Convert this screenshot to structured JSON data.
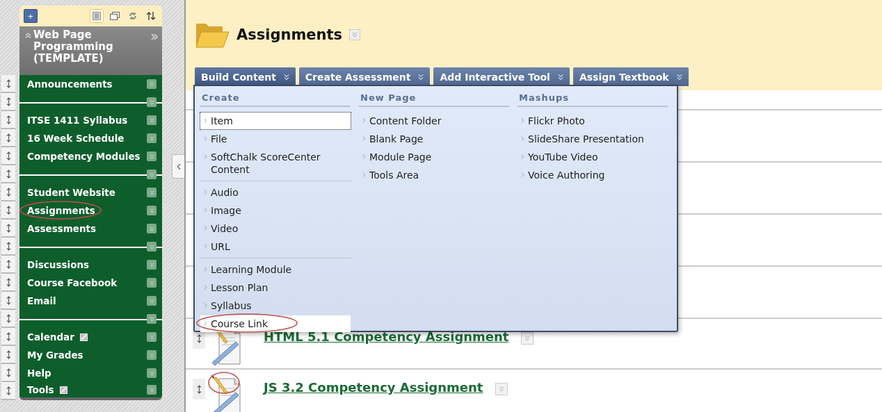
{
  "sidebar": {
    "add_button": "+",
    "view_tools": [
      {
        "kind": "list",
        "selected": true
      },
      {
        "kind": "window",
        "selected": false
      },
      {
        "kind": "refresh",
        "selected": false
      },
      {
        "kind": "sort",
        "selected": false
      }
    ],
    "course_title": "Web Page Programming (TEMPLATE)",
    "items": [
      {
        "kind": "link",
        "label": "Announcements",
        "external": false,
        "circled": false
      },
      {
        "kind": "divider"
      },
      {
        "kind": "link",
        "label": "ITSE 1411 Syllabus",
        "external": false,
        "circled": false
      },
      {
        "kind": "link",
        "label": "16 Week Schedule",
        "external": false,
        "circled": false
      },
      {
        "kind": "link",
        "label": "Competency Modules",
        "external": false,
        "circled": false
      },
      {
        "kind": "divider"
      },
      {
        "kind": "link",
        "label": "Student Website",
        "external": false,
        "circled": false
      },
      {
        "kind": "link",
        "label": "Assignments",
        "external": false,
        "circled": true
      },
      {
        "kind": "link",
        "label": "Assessments",
        "external": false,
        "circled": false
      },
      {
        "kind": "divider"
      },
      {
        "kind": "link",
        "label": "Discussions",
        "external": false,
        "circled": false
      },
      {
        "kind": "link",
        "label": "Course Facebook",
        "external": false,
        "circled": false
      },
      {
        "kind": "link",
        "label": "Email",
        "external": false,
        "circled": false
      },
      {
        "kind": "divider"
      },
      {
        "kind": "link",
        "label": "Calendar",
        "external": true,
        "circled": false
      },
      {
        "kind": "link",
        "label": "My Grades",
        "external": false,
        "circled": false
      },
      {
        "kind": "link",
        "label": "Help",
        "external": false,
        "circled": false
      },
      {
        "kind": "link",
        "label": "Tools",
        "external": true,
        "circled": false
      }
    ]
  },
  "page": {
    "title": "Assignments",
    "toolbar": [
      {
        "label": "Build Content",
        "expanded": true
      },
      {
        "label": "Create Assessment",
        "expanded": false
      },
      {
        "label": "Add Interactive Tool",
        "expanded": false
      },
      {
        "label": "Assign Textbook",
        "expanded": false
      }
    ],
    "menu": {
      "columns": [
        {
          "heading": "Create",
          "groups": [
            [
              {
                "label": "Item",
                "focused": true,
                "highlighted": false,
                "circled": false
              },
              {
                "label": "File",
                "focused": false,
                "highlighted": false,
                "circled": false
              },
              {
                "label": "SoftChalk ScoreCenter Content",
                "focused": false,
                "highlighted": false,
                "circled": false
              }
            ],
            [
              {
                "label": "Audio",
                "focused": false,
                "highlighted": false,
                "circled": false
              },
              {
                "label": "Image",
                "focused": false,
                "highlighted": false,
                "circled": false
              },
              {
                "label": "Video",
                "focused": false,
                "highlighted": false,
                "circled": false
              },
              {
                "label": "URL",
                "focused": false,
                "highlighted": false,
                "circled": false
              }
            ],
            [
              {
                "label": "Learning Module",
                "focused": false,
                "highlighted": false,
                "circled": false
              },
              {
                "label": "Lesson Plan",
                "focused": false,
                "highlighted": false,
                "circled": false
              },
              {
                "label": "Syllabus",
                "focused": false,
                "highlighted": false,
                "circled": false
              },
              {
                "label": "Course Link",
                "focused": false,
                "highlighted": true,
                "circled": true
              }
            ]
          ]
        },
        {
          "heading": "New Page",
          "groups": [
            [
              {
                "label": "Content Folder",
                "focused": false,
                "highlighted": false,
                "circled": false
              },
              {
                "label": "Blank Page",
                "focused": false,
                "highlighted": false,
                "circled": false
              },
              {
                "label": "Module Page",
                "focused": false,
                "highlighted": false,
                "circled": false
              },
              {
                "label": "Tools Area",
                "focused": false,
                "highlighted": false,
                "circled": false
              }
            ]
          ]
        },
        {
          "heading": "Mashups",
          "groups": [
            [
              {
                "label": "Flickr Photo",
                "focused": false,
                "highlighted": false,
                "circled": false
              },
              {
                "label": "SlideShare Presentation",
                "focused": false,
                "highlighted": false,
                "circled": false
              },
              {
                "label": "YouTube Video",
                "focused": false,
                "highlighted": false,
                "circled": false
              },
              {
                "label": "Voice Authoring",
                "focused": false,
                "highlighted": false,
                "circled": false
              }
            ]
          ]
        }
      ]
    },
    "items": [
      {
        "title": "HTML 5.1 Competency Assignment",
        "icon_circled": false
      },
      {
        "title": "JS 3.2 Competency Assignment",
        "icon_circled": true
      }
    ]
  }
}
